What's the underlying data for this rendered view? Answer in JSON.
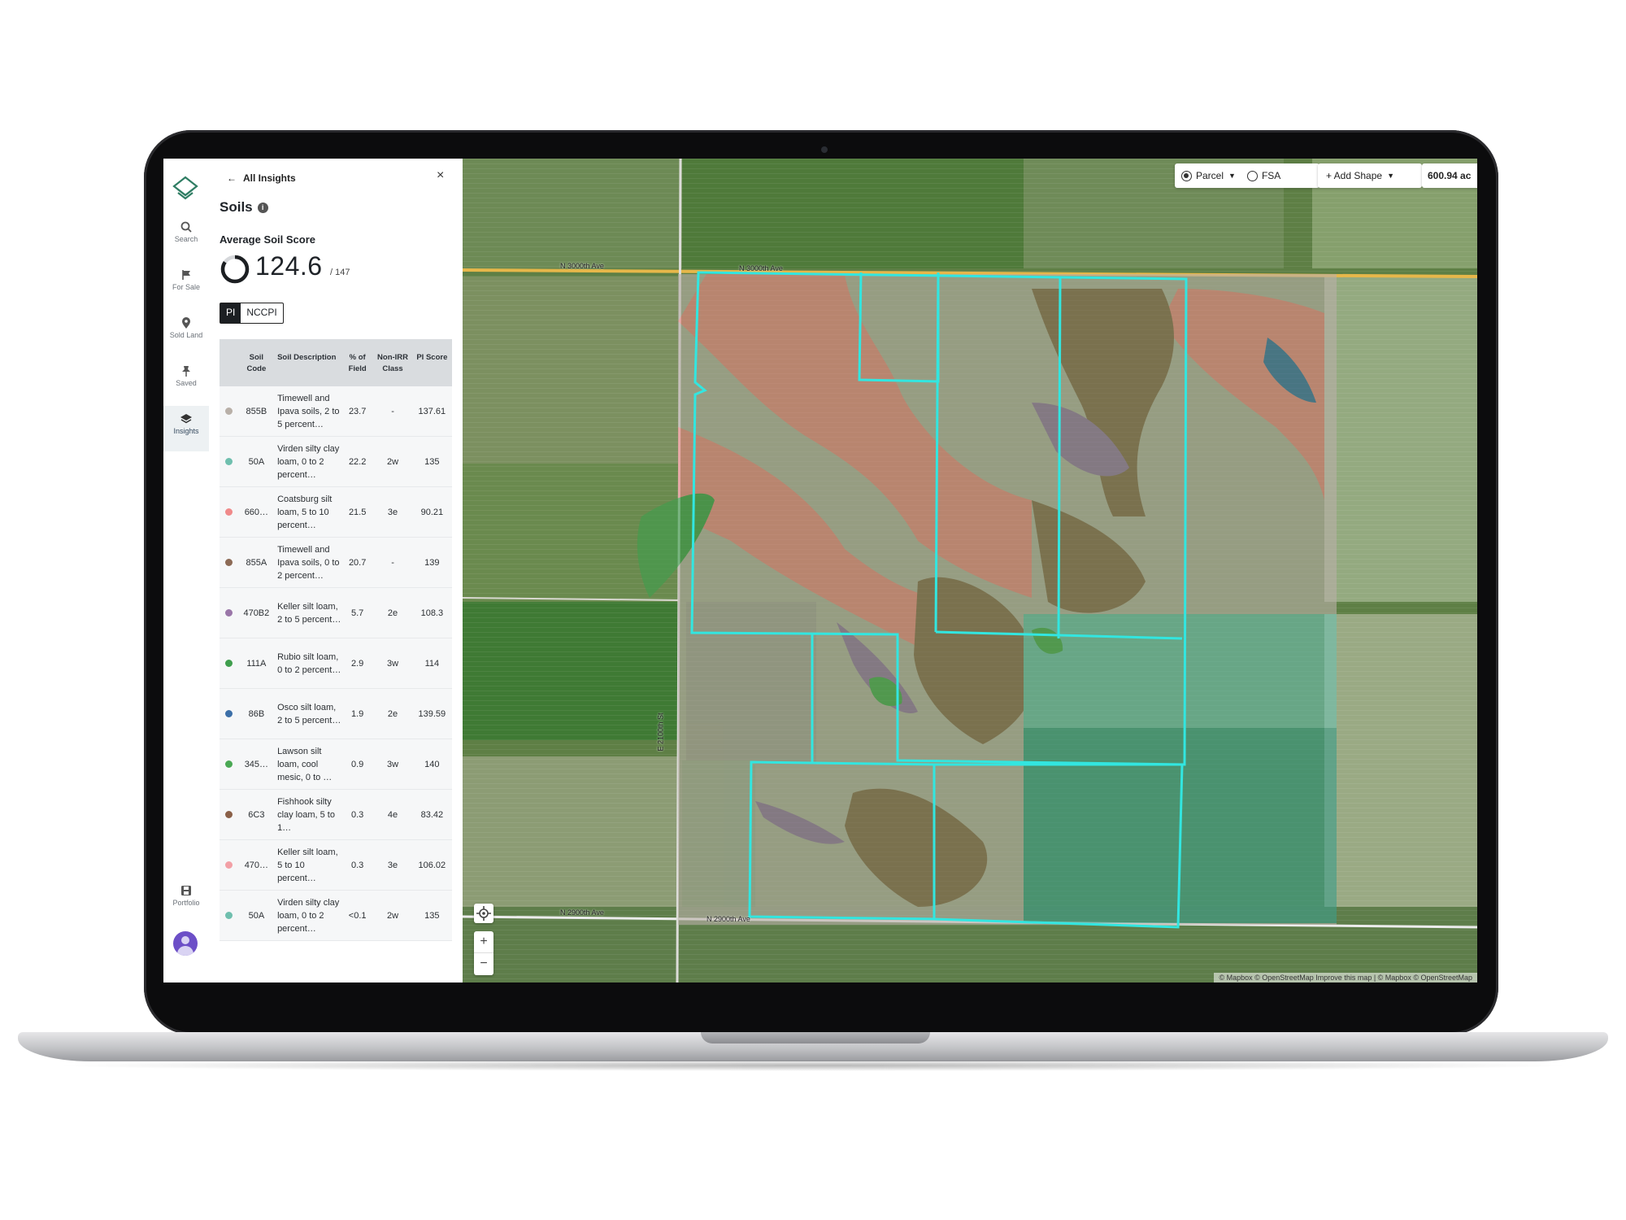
{
  "nav": {
    "items": [
      {
        "label": "Search",
        "icon": "search-icon"
      },
      {
        "label": "For Sale",
        "icon": "flag-icon"
      },
      {
        "label": "Sold Land",
        "icon": "map-pin-icon"
      },
      {
        "label": "Saved",
        "icon": "pushpin-icon"
      },
      {
        "label": "Insights",
        "icon": "layers-icon",
        "active": true
      }
    ],
    "portfolio_label": "Portfolio"
  },
  "panel": {
    "back_label": "All Insights",
    "close_symbol": "×",
    "title": "Soils",
    "avg_label": "Average Soil Score",
    "avg_score": "124.6",
    "avg_max": "/ 147",
    "toggle": [
      "PI",
      "NCCPI"
    ],
    "columns": [
      "Soil Code",
      "Soil Description",
      "% of Field",
      "Non-IRR Class",
      "PI Score"
    ],
    "rows": [
      {
        "color": "#b9b0a8",
        "code": "855B",
        "desc": "Timewell and Ipava soils, 2 to 5 percent…",
        "pct": "23.7",
        "cls": "-",
        "pi": "137.61"
      },
      {
        "color": "#6fbfae",
        "code": "50A",
        "desc": "Virden silty clay loam, 0 to 2 percent…",
        "pct": "22.2",
        "cls": "2w",
        "pi": "135"
      },
      {
        "color": "#f08a8a",
        "code": "660…",
        "desc": "Coatsburg silt loam, 5 to 10 percent…",
        "pct": "21.5",
        "cls": "3e",
        "pi": "90.21"
      },
      {
        "color": "#8c6a55",
        "code": "855A",
        "desc": "Timewell and Ipava soils, 0 to 2 percent…",
        "pct": "20.7",
        "cls": "-",
        "pi": "139"
      },
      {
        "color": "#9a76a8",
        "code": "470B2",
        "desc": "Keller silt loam, 2 to 5 percent…",
        "pct": "5.7",
        "cls": "2e",
        "pi": "108.3"
      },
      {
        "color": "#3f9e4d",
        "code": "111A",
        "desc": "Rubio silt loam, 0 to 2 percent…",
        "pct": "2.9",
        "cls": "3w",
        "pi": "114"
      },
      {
        "color": "#3c6fa8",
        "code": "86B",
        "desc": "Osco silt loam, 2 to 5 percent…",
        "pct": "1.9",
        "cls": "2e",
        "pi": "139.59"
      },
      {
        "color": "#4aa854",
        "code": "345…",
        "desc": "Lawson silt loam, cool mesic, 0 to …",
        "pct": "0.9",
        "cls": "3w",
        "pi": "140"
      },
      {
        "color": "#8a6048",
        "code": "6C3",
        "desc": "Fishhook silty clay loam, 5 to 1…",
        "pct": "0.3",
        "cls": "4e",
        "pi": "83.42"
      },
      {
        "color": "#f2a0a6",
        "code": "470…",
        "desc": "Keller silt loam, 5 to 10 percent…",
        "pct": "0.3",
        "cls": "3e",
        "pi": "106.02"
      },
      {
        "color": "#6fbfae",
        "code": "50A",
        "desc": "Virden silty clay loam, 0 to 2 percent…",
        "pct": "<0.1",
        "cls": "2w",
        "pi": "135"
      }
    ]
  },
  "map": {
    "parcel_label": "Parcel",
    "fsa_label": "FSA",
    "add_shape_label": "+ Add Shape",
    "acreage": "600.94 ac",
    "roads": [
      "N 3000th Ave",
      "N 2900th Ave",
      "E 2100th St",
      "N 2900th Ave"
    ],
    "attribution": "© Mapbox © OpenStreetMap  Improve this map  |  © Mapbox © OpenStreetMap",
    "zoom_in": "+",
    "zoom_out": "−"
  },
  "colors": {
    "boundary": "#32e6e0",
    "accent": "#2f7d63"
  }
}
